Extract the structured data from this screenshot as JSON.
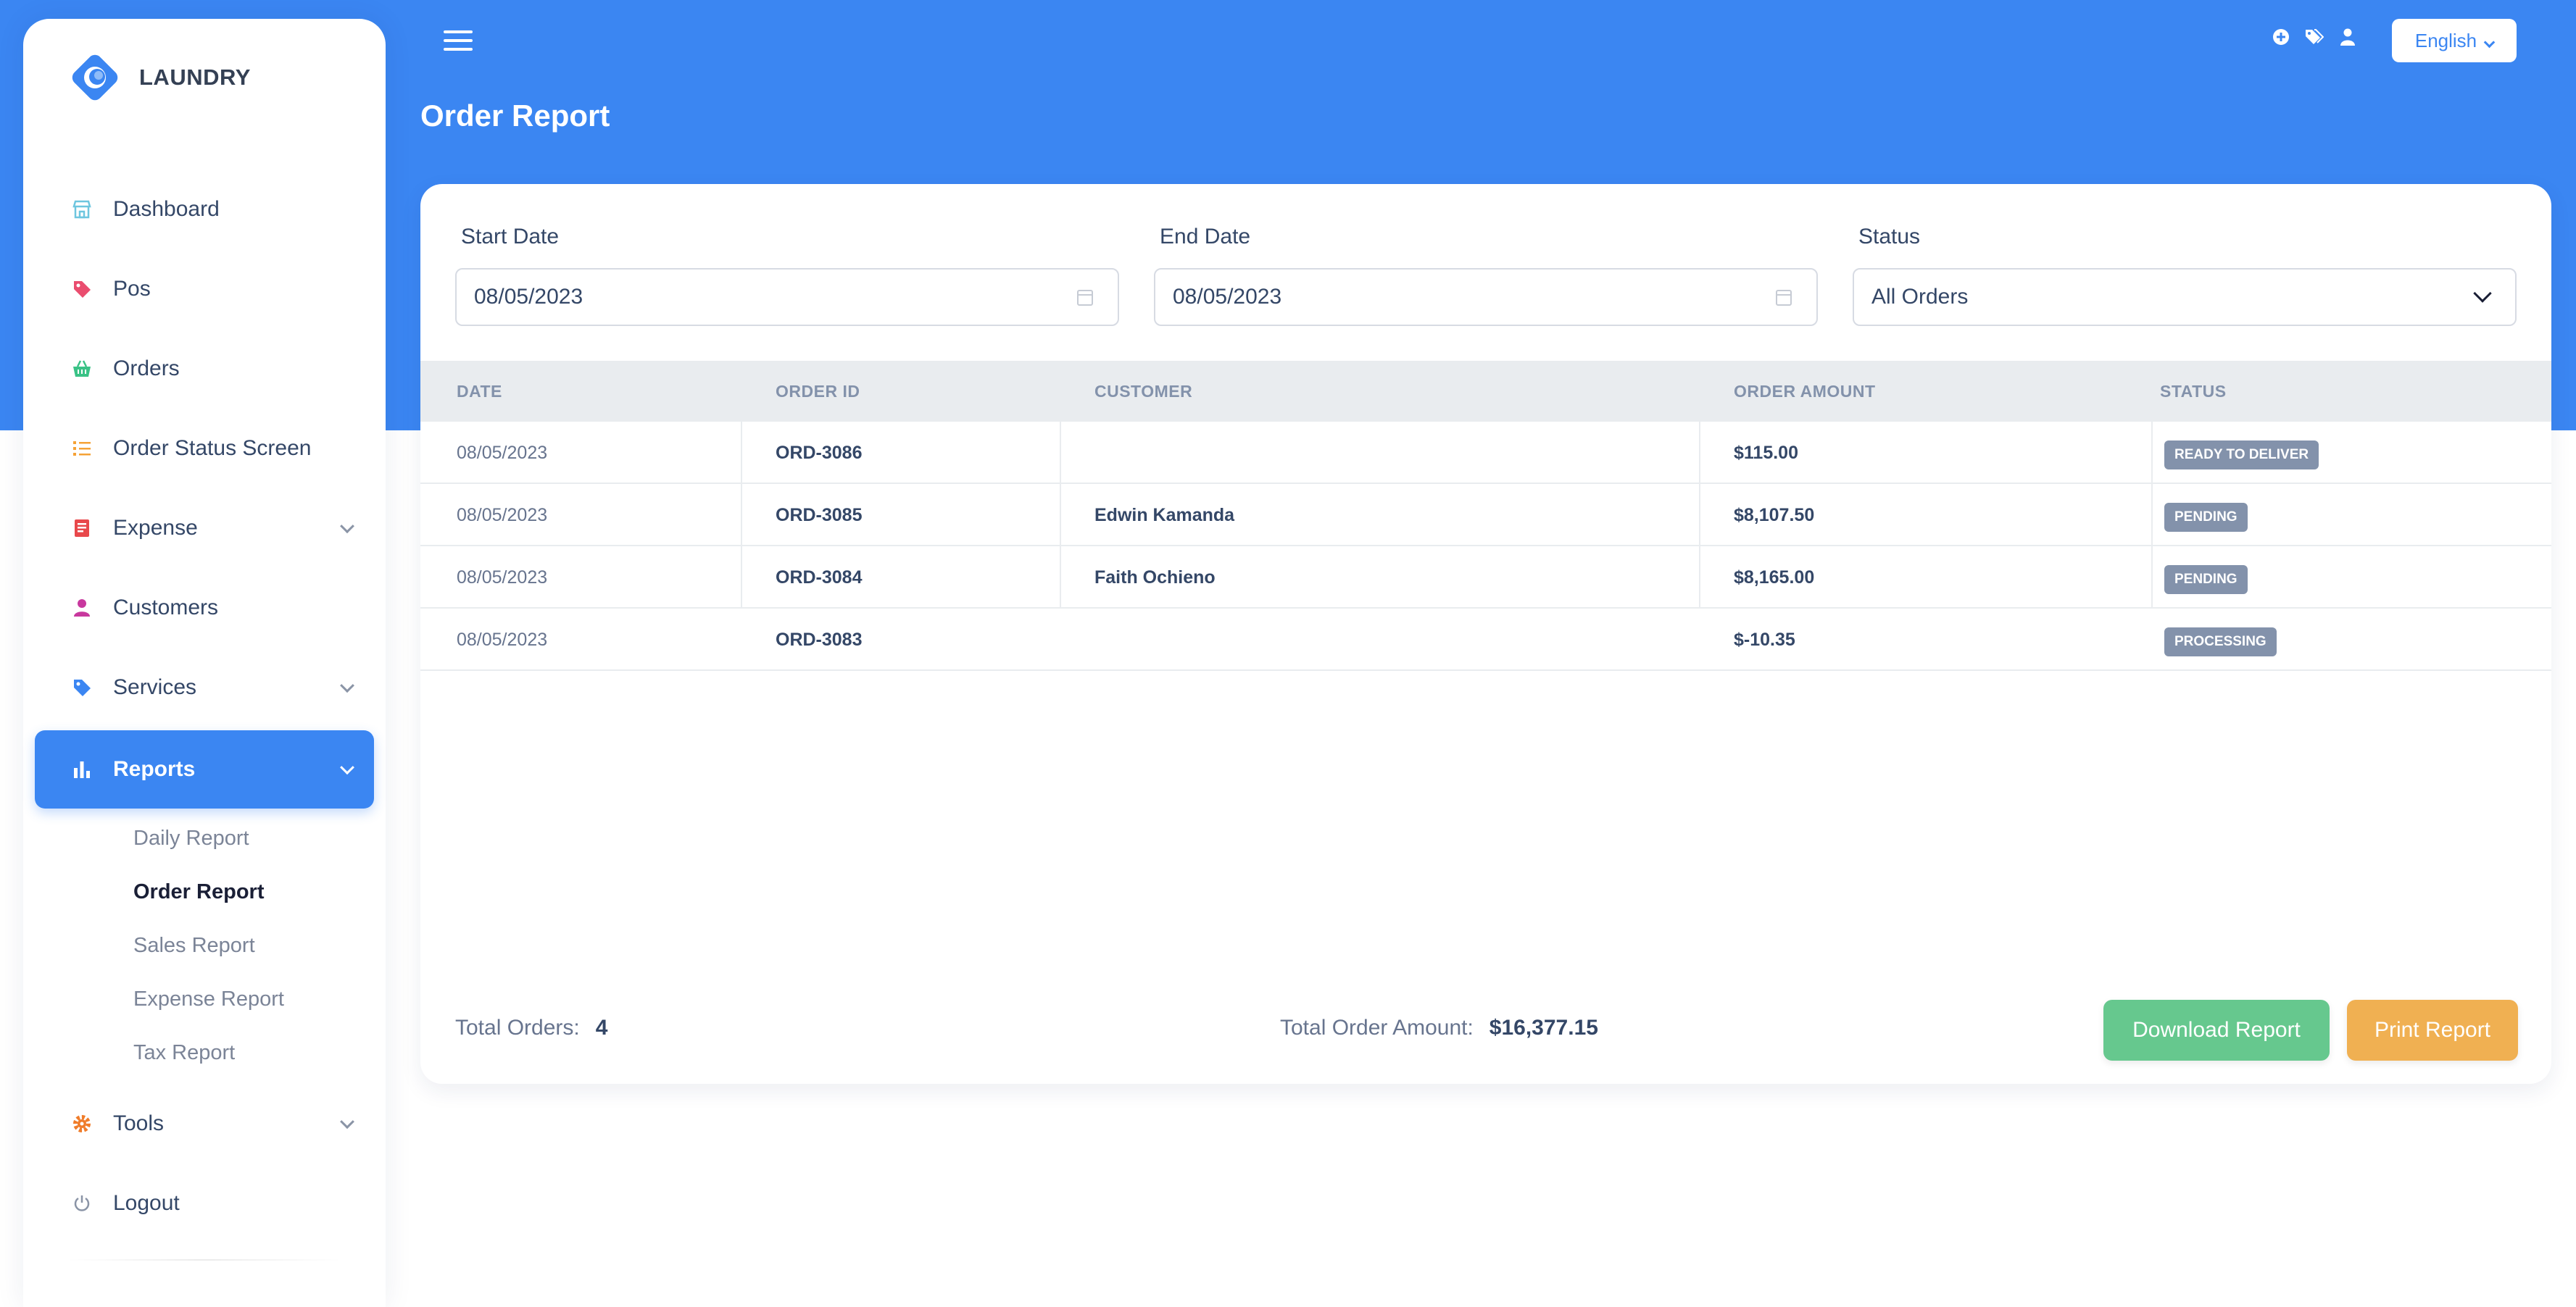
{
  "brand": {
    "name": "LAUNDRY"
  },
  "sidebar": {
    "items": [
      {
        "label": "Dashboard",
        "icon": "store-icon"
      },
      {
        "label": "Pos",
        "icon": "tag-icon"
      },
      {
        "label": "Orders",
        "icon": "basket-icon"
      },
      {
        "label": "Order Status Screen",
        "icon": "list-icon"
      },
      {
        "label": "Expense",
        "icon": "receipt-icon"
      },
      {
        "label": "Customers",
        "icon": "user-icon"
      },
      {
        "label": "Services",
        "icon": "tag-icon"
      },
      {
        "label": "Reports",
        "icon": "bar-chart-icon"
      },
      {
        "label": "Tools",
        "icon": "gear-icon"
      },
      {
        "label": "Logout",
        "icon": "power-icon"
      }
    ],
    "report_subitems": [
      "Daily Report",
      "Order Report",
      "Sales Report",
      "Expense Report",
      "Tax Report"
    ]
  },
  "header": {
    "language": "English",
    "icons": [
      "plus-circle-icon",
      "tags-icon",
      "user-icon"
    ]
  },
  "page": {
    "title": "Order Report"
  },
  "filters": {
    "start_date_label": "Start Date",
    "start_date_value": "08/05/2023",
    "end_date_label": "End Date",
    "end_date_value": "08/05/2023",
    "status_label": "Status",
    "status_value": "All Orders"
  },
  "table": {
    "columns": [
      "DATE",
      "ORDER ID",
      "CUSTOMER",
      "ORDER AMOUNT",
      "STATUS"
    ],
    "rows": [
      {
        "date": "08/05/2023",
        "order_id": "ORD-3086",
        "customer": "",
        "amount": "$115.00",
        "status": "READY TO DELIVER"
      },
      {
        "date": "08/05/2023",
        "order_id": "ORD-3085",
        "customer": "Edwin Kamanda",
        "amount": "$8,107.50",
        "status": "PENDING"
      },
      {
        "date": "08/05/2023",
        "order_id": "ORD-3084",
        "customer": "Faith Ochieno",
        "amount": "$8,165.00",
        "status": "PENDING"
      },
      {
        "date": "08/05/2023",
        "order_id": "ORD-3083",
        "customer": "",
        "amount": "$-10.35",
        "status": "PROCESSING"
      }
    ]
  },
  "footer": {
    "total_orders_label": "Total Orders:",
    "total_orders_value": "4",
    "total_amount_label": "Total Order Amount:",
    "total_amount_value": "$16,377.15",
    "download_label": "Download Report",
    "print_label": "Print Report"
  },
  "colors": {
    "primary": "#3b86f2",
    "download": "#66c88e",
    "print": "#f0b052",
    "badge": "#8392ab"
  }
}
